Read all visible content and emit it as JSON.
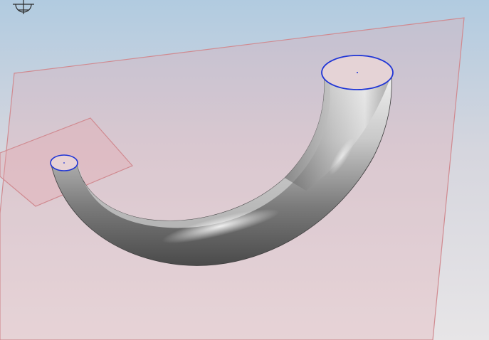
{
  "viewport": {
    "background_top": "#b3cde0",
    "background_mid": "#ddd9dc",
    "background_bottom": "#e8e6e8"
  },
  "icons": {
    "triad": "coordinate-triad-icon"
  },
  "colors": {
    "plane_fill": "#e7a6ab",
    "plane_edge": "#cc7a80",
    "profile_edge": "#1f35d6",
    "sweep_body": "#8a8a8a"
  }
}
